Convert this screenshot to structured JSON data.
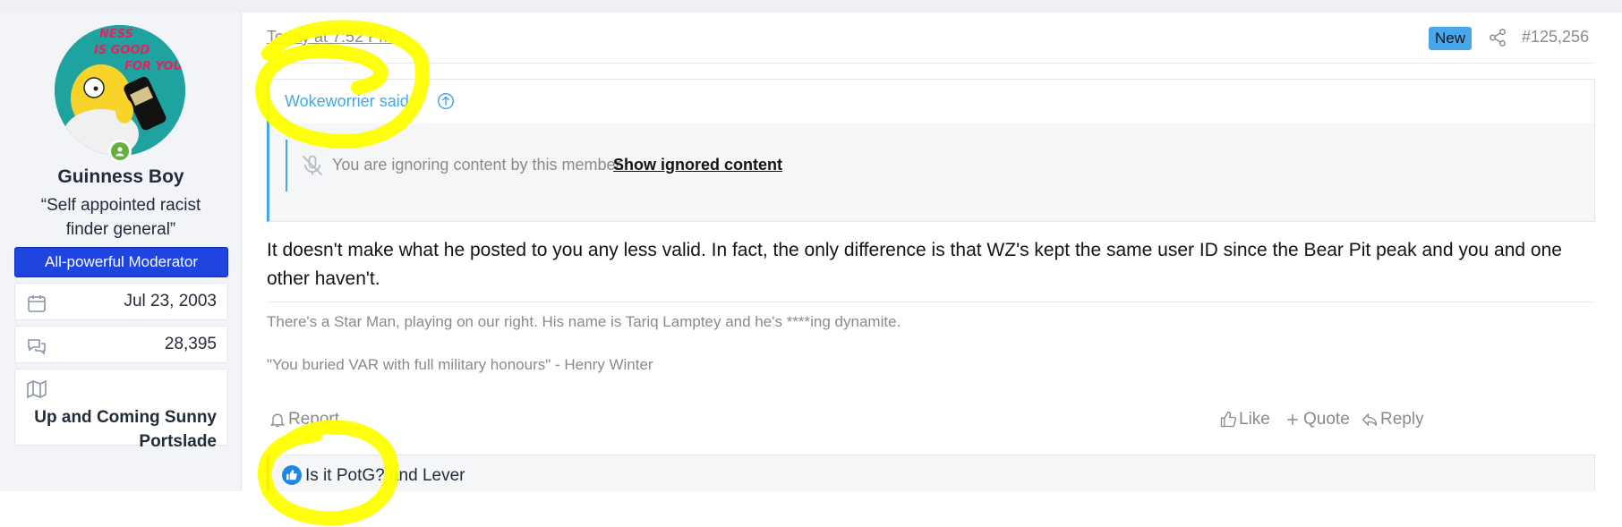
{
  "user": {
    "avatar_caption": "NESS IS GOOD FOR YOU",
    "name": "Guinness Boy",
    "title": "“Self appointed racist finder general”",
    "banner": "All-powerful Moderator",
    "joined": "Jul 23, 2003",
    "messages": "28,395",
    "location": "Up and Coming Sunny Portslade",
    "icons": {
      "joined": "calendar-icon",
      "messages": "speech-bubbles-icon",
      "location": "map-icon",
      "status": "online-user-icon"
    },
    "status_color": "#63b13c"
  },
  "post": {
    "date": "Today at 7:52 PM",
    "new_badge": "New",
    "number": "#125,256",
    "quote": {
      "author": "Wokeworrier said:",
      "ignored_msg": "You are ignoring content by this member.",
      "show_ignored": "Show ignored content"
    },
    "body": "It doesn't make what he posted to you any less valid. In fact, the only difference is that WZ's kept the same user ID since the Bear Pit peak and you and one other haven't.",
    "signature": [
      "There's a Star Man, playing on our right. His name is Tariq Lamptey and he's ****ing dynamite.",
      "\"You buried VAR with full military honours\" - Henry Winter"
    ],
    "actions": {
      "report": "Report",
      "like": "Like",
      "quote": "Quote",
      "reply": "Reply"
    },
    "reactions": "Is it PotG? and Lever"
  },
  "colors": {
    "accent": "#47a7eb",
    "banner": "#1f45e0",
    "highlighter": "#ffff00"
  }
}
